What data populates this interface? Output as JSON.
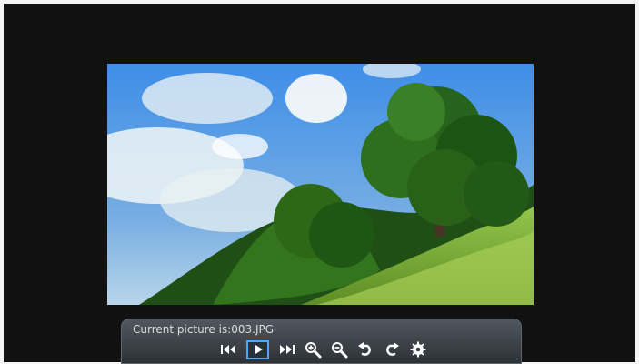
{
  "viewer": {
    "caption": "Current picture is:003.JPG",
    "selected_button": "play",
    "icons": [
      "previous-icon",
      "play-icon",
      "next-icon",
      "zoom-in-icon",
      "zoom-out-icon",
      "rotate-left-icon",
      "rotate-right-icon",
      "settings-icon"
    ],
    "colors": {
      "screen": "#111111",
      "bar_top": "#50575e",
      "bar_bottom": "#2d3237",
      "selection": "#48a9ff",
      "icon": "#ffffff"
    }
  }
}
